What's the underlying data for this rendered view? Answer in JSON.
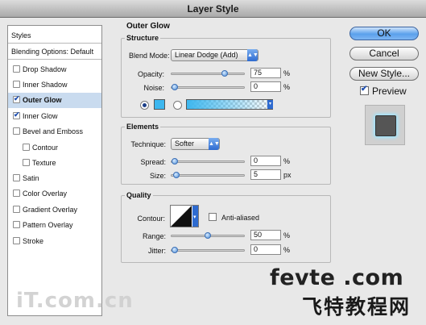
{
  "window": {
    "title": "Layer Style"
  },
  "styles_list": [
    {
      "label": "Styles",
      "checkbox": false,
      "checked": false,
      "selected": false,
      "indent": false,
      "header": true
    },
    {
      "label": "Blending Options: Default",
      "checkbox": false,
      "checked": false,
      "selected": false,
      "indent": false,
      "header": true
    },
    {
      "label": "Drop Shadow",
      "checkbox": true,
      "checked": false,
      "selected": false,
      "indent": false
    },
    {
      "label": "Inner Shadow",
      "checkbox": true,
      "checked": false,
      "selected": false,
      "indent": false
    },
    {
      "label": "Outer Glow",
      "checkbox": true,
      "checked": true,
      "selected": true,
      "indent": false
    },
    {
      "label": "Inner Glow",
      "checkbox": true,
      "checked": true,
      "selected": false,
      "indent": false
    },
    {
      "label": "Bevel and Emboss",
      "checkbox": true,
      "checked": false,
      "selected": false,
      "indent": false
    },
    {
      "label": "Contour",
      "checkbox": true,
      "checked": false,
      "selected": false,
      "indent": true
    },
    {
      "label": "Texture",
      "checkbox": true,
      "checked": false,
      "selected": false,
      "indent": true
    },
    {
      "label": "Satin",
      "checkbox": true,
      "checked": false,
      "selected": false,
      "indent": false
    },
    {
      "label": "Color Overlay",
      "checkbox": true,
      "checked": false,
      "selected": false,
      "indent": false
    },
    {
      "label": "Gradient Overlay",
      "checkbox": true,
      "checked": false,
      "selected": false,
      "indent": false
    },
    {
      "label": "Pattern Overlay",
      "checkbox": true,
      "checked": false,
      "selected": false,
      "indent": false
    },
    {
      "label": "Stroke",
      "checkbox": true,
      "checked": false,
      "selected": false,
      "indent": false
    }
  ],
  "outer_glow": {
    "title": "Outer Glow",
    "structure": {
      "title": "Structure",
      "blend_mode_label": "Blend Mode:",
      "blend_mode_value": "Linear Dodge (Add)",
      "opacity_label": "Opacity:",
      "opacity_value": "75",
      "opacity_unit": "%",
      "opacity_level": 0.75,
      "noise_label": "Noise:",
      "noise_value": "0",
      "noise_unit": "%",
      "noise_level": 0,
      "glow_color": "#3db7ef",
      "gradient_start": "#3db7ef"
    },
    "elements": {
      "title": "Elements",
      "technique_label": "Technique:",
      "technique_value": "Softer",
      "spread_label": "Spread:",
      "spread_value": "0",
      "spread_unit": "%",
      "spread_level": 0,
      "size_label": "Size:",
      "size_value": "5",
      "size_unit": "px",
      "size_level": 0.02
    },
    "quality": {
      "title": "Quality",
      "contour_label": "Contour:",
      "anti_aliased_label": "Anti-aliased",
      "anti_aliased_checked": false,
      "range_label": "Range:",
      "range_value": "50",
      "range_unit": "%",
      "range_level": 0.5,
      "jitter_label": "Jitter:",
      "jitter_value": "0",
      "jitter_unit": "%",
      "jitter_level": 0
    }
  },
  "buttons": {
    "ok": "OK",
    "cancel": "Cancel",
    "new_style": "New Style...",
    "preview": "Preview",
    "preview_checked": true
  },
  "watermark": {
    "site": "fevte .com",
    "chinese": "飞特教程网",
    "left": "iT.com.cn"
  }
}
